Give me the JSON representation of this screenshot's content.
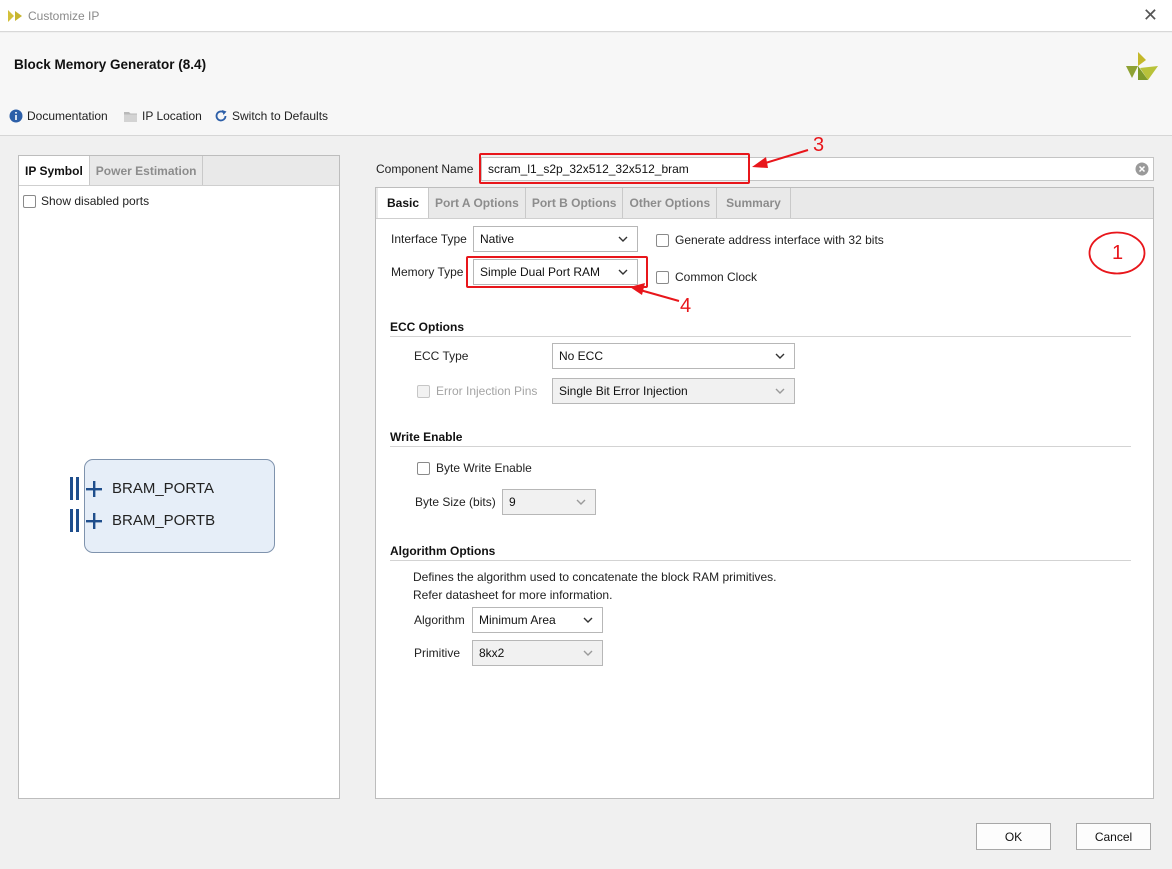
{
  "window": {
    "title": "Customize IP",
    "close_glyph": "✕"
  },
  "header": {
    "title": "Block Memory Generator (8.4)",
    "toolbar": {
      "documentation": "Documentation",
      "ip_location": "IP Location",
      "switch_defaults": "Switch to Defaults"
    }
  },
  "left_panel": {
    "tabs": [
      "IP Symbol",
      "Power Estimation"
    ],
    "show_disabled_ports": "Show disabled ports",
    "ports": [
      "BRAM_PORTA",
      "BRAM_PORTB"
    ]
  },
  "component": {
    "label": "Component Name",
    "value": "scram_l1_s2p_32x512_32x512_bram"
  },
  "tabs": [
    "Basic",
    "Port A Options",
    "Port B Options",
    "Other Options",
    "Summary"
  ],
  "basic": {
    "interface_type_label": "Interface Type",
    "interface_type_value": "Native",
    "gen_addr_label": "Generate address interface with 32 bits",
    "memory_type_label": "Memory Type",
    "memory_type_value": "Simple Dual Port RAM",
    "common_clock_label": "Common Clock"
  },
  "ecc": {
    "title": "ECC Options",
    "type_label": "ECC Type",
    "type_value": "No ECC",
    "injection_label": "Error Injection Pins",
    "injection_value": "Single Bit Error Injection"
  },
  "write_enable": {
    "title": "Write Enable",
    "byte_write_label": "Byte Write Enable",
    "byte_size_label": "Byte Size (bits)",
    "byte_size_value": "9"
  },
  "algorithm": {
    "title": "Algorithm Options",
    "desc1": "Defines the algorithm used to concatenate the block RAM primitives.",
    "desc2": "Refer datasheet for more information.",
    "algorithm_label": "Algorithm",
    "algorithm_value": "Minimum Area",
    "primitive_label": "Primitive",
    "primitive_value": "8kx2"
  },
  "buttons": {
    "ok": "OK",
    "cancel": "Cancel"
  },
  "annotations": {
    "a1": "1",
    "a3": "3",
    "a4": "4"
  },
  "colors": {
    "annotation_red": "#e8161b",
    "port_blue": "#1f4e8c",
    "symbol_fill": "#e6eef8"
  },
  "icons": [
    "vivado-logo-icon",
    "info-icon",
    "folder-icon",
    "refresh-icon",
    "clear-icon",
    "chevron-down-icon",
    "plus-icon"
  ]
}
